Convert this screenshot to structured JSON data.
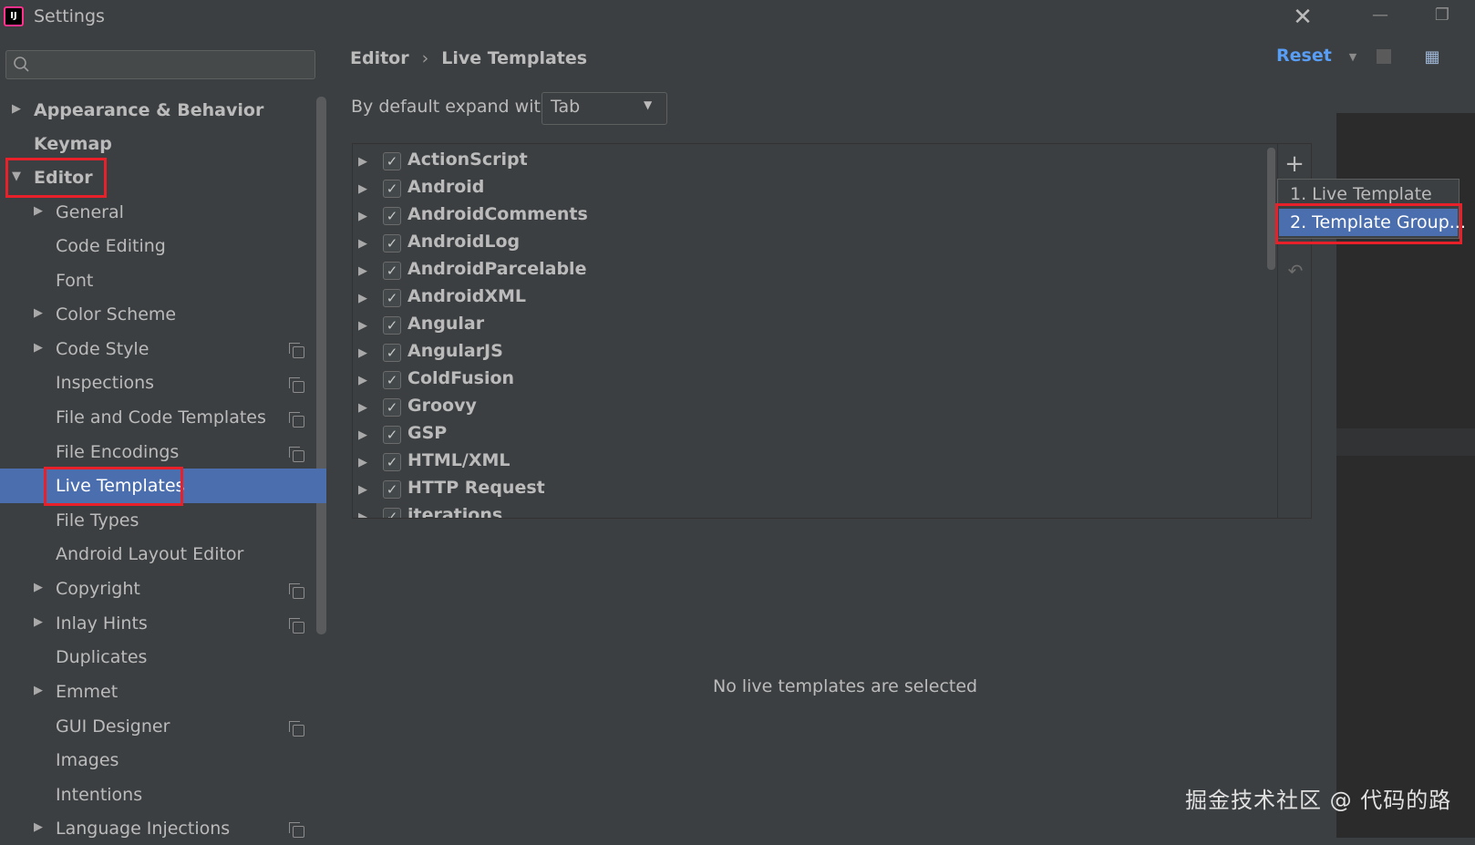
{
  "window": {
    "title": "Settings",
    "app_icon": "IJ"
  },
  "sidebar": {
    "search": {
      "placeholder": ""
    },
    "items": [
      {
        "label": "Appearance & Behavior"
      },
      {
        "label": "Keymap"
      },
      {
        "label": "Editor"
      },
      {
        "label": "General"
      },
      {
        "label": "Code Editing"
      },
      {
        "label": "Font"
      },
      {
        "label": "Color Scheme"
      },
      {
        "label": "Code Style"
      },
      {
        "label": "Inspections"
      },
      {
        "label": "File and Code Templates"
      },
      {
        "label": "File Encodings"
      },
      {
        "label": "Live Templates"
      },
      {
        "label": "File Types"
      },
      {
        "label": "Android Layout Editor"
      },
      {
        "label": "Copyright"
      },
      {
        "label": "Inlay Hints"
      },
      {
        "label": "Duplicates"
      },
      {
        "label": "Emmet"
      },
      {
        "label": "GUI Designer"
      },
      {
        "label": "Images"
      },
      {
        "label": "Intentions"
      },
      {
        "label": "Language Injections"
      }
    ],
    "selected": "Live Templates",
    "highlight_color": "#4b6eaf"
  },
  "breadcrumb": {
    "parent": "Editor",
    "separator": "›",
    "current": "Live Templates"
  },
  "toolbar": {
    "reset_label": "Reset",
    "reset_color": "#589df6"
  },
  "expand": {
    "label": "By default expand with",
    "value": "Tab"
  },
  "template_groups": [
    {
      "name": "ActionScript",
      "checked": true
    },
    {
      "name": "Android",
      "checked": true
    },
    {
      "name": "AndroidComments",
      "checked": true
    },
    {
      "name": "AndroidLog",
      "checked": true
    },
    {
      "name": "AndroidParcelable",
      "checked": true
    },
    {
      "name": "AndroidXML",
      "checked": true
    },
    {
      "name": "Angular",
      "checked": true
    },
    {
      "name": "AngularJS",
      "checked": true
    },
    {
      "name": "ColdFusion",
      "checked": true
    },
    {
      "name": "Groovy",
      "checked": true
    },
    {
      "name": "GSP",
      "checked": true
    },
    {
      "name": "HTML/XML",
      "checked": true
    },
    {
      "name": "HTTP Request",
      "checked": true
    },
    {
      "name": "iterations",
      "checked": true
    }
  ],
  "side_buttons": {
    "add": "+",
    "undo_icon": "undo-icon"
  },
  "popup": {
    "items": [
      {
        "label": "1. Live Template"
      },
      {
        "label": "2. Template Group..."
      }
    ],
    "highlighted": "2. Template Group..."
  },
  "detail": {
    "empty_text": "No live templates are selected"
  },
  "watermark": "掘金技术社区 @ 代码的路",
  "annotation_color": "#e8202a"
}
